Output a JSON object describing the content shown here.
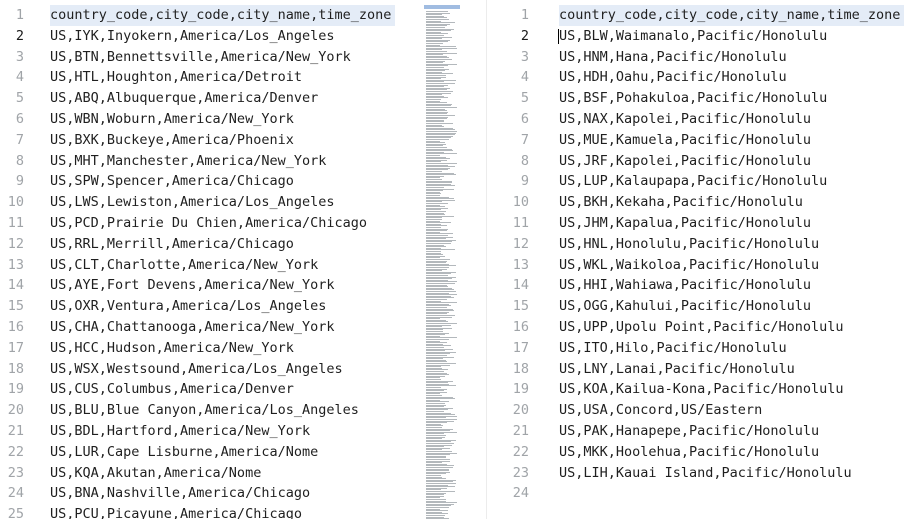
{
  "left_editor": {
    "header": "country_code,city_code,city_name,time_zone",
    "lines": [
      "US,IYK,Inyokern,America/Los_Angeles",
      "US,BTN,Bennettsville,America/New_York",
      "US,HTL,Houghton,America/Detroit",
      "US,ABQ,Albuquerque,America/Denver",
      "US,WBN,Woburn,America/New_York",
      "US,BXK,Buckeye,America/Phoenix",
      "US,MHT,Manchester,America/New_York",
      "US,SPW,Spencer,America/Chicago",
      "US,LWS,Lewiston,America/Los_Angeles",
      "US,PCD,Prairie Du Chien,America/Chicago",
      "US,RRL,Merrill,America/Chicago",
      "US,CLT,Charlotte,America/New_York",
      "US,AYE,Fort Devens,America/New_York",
      "US,OXR,Ventura,America/Los_Angeles",
      "US,CHA,Chattanooga,America/New_York",
      "US,HCC,Hudson,America/New_York",
      "US,WSX,Westsound,America/Los_Angeles",
      "US,CUS,Columbus,America/Denver",
      "US,BLU,Blue Canyon,America/Los_Angeles",
      "US,BDL,Hartford,America/New_York",
      "US,LUR,Cape Lisburne,America/Nome",
      "US,KQA,Akutan,America/Nome",
      "US,BNA,Nashville,America/Chicago",
      "US,PCU,Picayune,America/Chicago"
    ],
    "line_numbers": [
      "1",
      "2",
      "3",
      "4",
      "5",
      "6",
      "7",
      "8",
      "9",
      "10",
      "11",
      "12",
      "13",
      "14",
      "15",
      "16",
      "17",
      "18",
      "19",
      "20",
      "21",
      "22",
      "23",
      "24",
      "25"
    ],
    "current_line": 2
  },
  "right_editor": {
    "header": "country_code,city_code,city_name,time_zone",
    "lines": [
      "US,BLW,Waimanalo,Pacific/Honolulu",
      "US,HNM,Hana,Pacific/Honolulu",
      "US,HDH,Oahu,Pacific/Honolulu",
      "US,BSF,Pohakuloa,Pacific/Honolulu",
      "US,NAX,Kapolei,Pacific/Honolulu",
      "US,MUE,Kamuela,Pacific/Honolulu",
      "US,JRF,Kapolei,Pacific/Honolulu",
      "US,LUP,Kalaupapa,Pacific/Honolulu",
      "US,BKH,Kekaha,Pacific/Honolulu",
      "US,JHM,Kapalua,Pacific/Honolulu",
      "US,HNL,Honolulu,Pacific/Honolulu",
      "US,WKL,Waikoloa,Pacific/Honolulu",
      "US,HHI,Wahiawa,Pacific/Honolulu",
      "US,OGG,Kahului,Pacific/Honolulu",
      "US,UPP,Upolu Point,Pacific/Honolulu",
      "US,ITO,Hilo,Pacific/Honolulu",
      "US,LNY,Lanai,Pacific/Honolulu",
      "US,KOA,Kailua-Kona,Pacific/Honolulu",
      "US,USA,Concord,US/Eastern",
      "US,PAK,Hanapepe,Pacific/Honolulu",
      "US,MKK,Hoolehua,Pacific/Honolulu",
      "US,LIH,Kauai Island,Pacific/Honolulu",
      ""
    ],
    "line_numbers": [
      "1",
      "2",
      "3",
      "4",
      "5",
      "6",
      "7",
      "8",
      "9",
      "10",
      "11",
      "12",
      "13",
      "14",
      "15",
      "16",
      "17",
      "18",
      "19",
      "20",
      "21",
      "22",
      "23",
      "24"
    ],
    "current_line": 2
  },
  "colors": {
    "header_highlight": "#e4ecf7",
    "line_number": "#a0a4a8",
    "current_line_number": "#1a1a1a",
    "text": "#1f1f1f",
    "minimap_viewport": "#8fb0dc"
  }
}
